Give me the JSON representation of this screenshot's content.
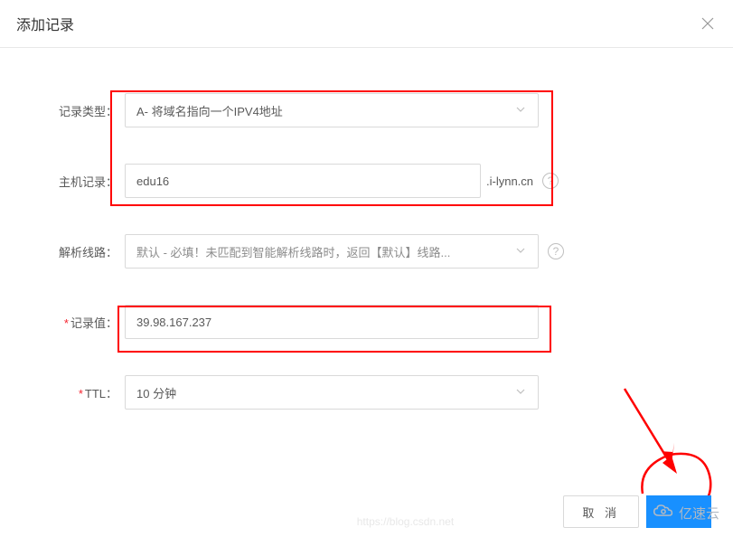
{
  "modal": {
    "title": "添加记录"
  },
  "form": {
    "recordType": {
      "label": "记录类型：",
      "value": "A- 将域名指向一个IPV4地址"
    },
    "hostRecord": {
      "label": "主机记录：",
      "value": "edu16",
      "suffix": ".i-lynn.cn"
    },
    "resolveLine": {
      "label": "解析线路：",
      "value": "默认 - 必填！未匹配到智能解析线路时，返回【默认】线路..."
    },
    "recordValue": {
      "label": "记录值：",
      "value": "39.98.167.237"
    },
    "ttl": {
      "label": "TTL：",
      "value": "10 分钟"
    }
  },
  "footer": {
    "cancel": "取 消"
  },
  "watermark": {
    "text": "亿速云",
    "url": "https://blog.csdn.net"
  }
}
